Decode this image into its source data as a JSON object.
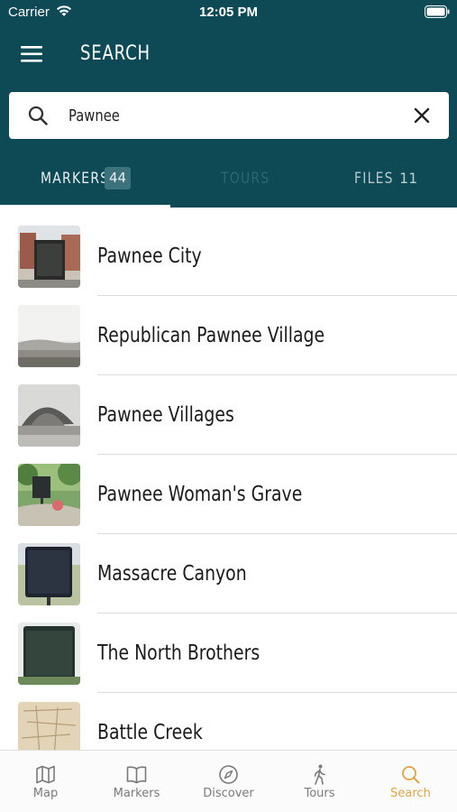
{
  "status_bar": {
    "carrier": "Carrier",
    "time": "12:05 PM"
  },
  "header": {
    "title": "SEARCH"
  },
  "search": {
    "value": "Pawnee",
    "placeholder": ""
  },
  "tabs": [
    {
      "label": "MARKERS",
      "count": "44"
    },
    {
      "label": "TOURS"
    },
    {
      "label": "FILES",
      "count": "11"
    }
  ],
  "results": [
    {
      "title": "Pawnee City"
    },
    {
      "title": "Republican Pawnee Village"
    },
    {
      "title": "Pawnee Villages"
    },
    {
      "title": "Pawnee Woman's Grave"
    },
    {
      "title": "Massacre Canyon"
    },
    {
      "title": "The North Brothers"
    },
    {
      "title": "Battle Creek"
    }
  ],
  "tabbar": [
    {
      "label": "Map",
      "icon": "map-icon"
    },
    {
      "label": "Markers",
      "icon": "book-icon"
    },
    {
      "label": "Discover",
      "icon": "compass-icon"
    },
    {
      "label": "Tours",
      "icon": "walking-icon"
    },
    {
      "label": "Search",
      "icon": "search-icon"
    }
  ],
  "colors": {
    "header": "#0d4a55",
    "accent": "#e0a445",
    "badge": "#3c727c"
  }
}
